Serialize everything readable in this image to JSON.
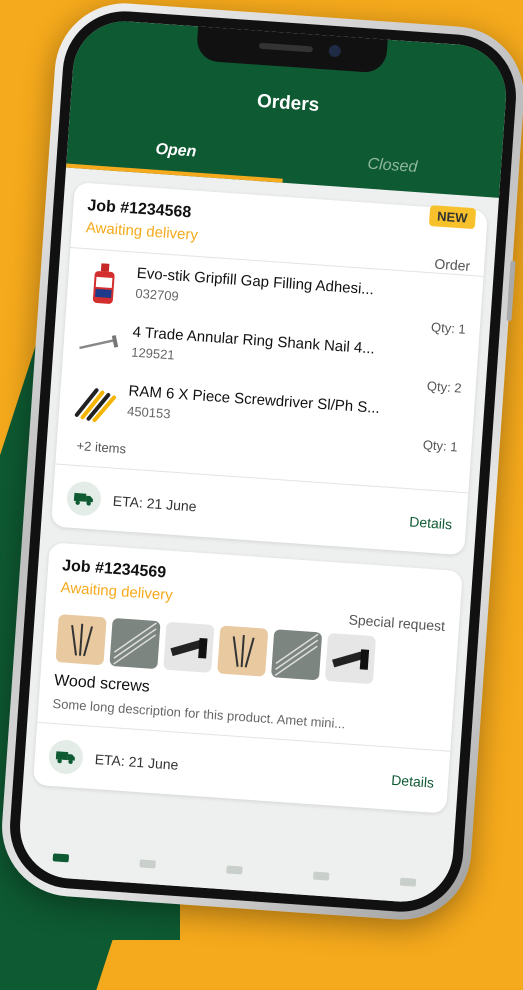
{
  "colors": {
    "brand_green": "#0e5a32",
    "accent": "#f5a91c"
  },
  "header": {
    "title": "Orders"
  },
  "tabs": [
    {
      "label": "Open",
      "active": true
    },
    {
      "label": "Closed",
      "active": false
    }
  ],
  "orders": [
    {
      "badge": "NEW",
      "job": "Job #1234568",
      "status": "Awaiting delivery",
      "type": "Order",
      "items": [
        {
          "name": "Evo-stik Gripfill Gap Filling Adhesi...",
          "code": "032709",
          "qty": "Qty: 1",
          "icon": "adhesive-bottle-icon"
        },
        {
          "name": "4 Trade Annular Ring Shank Nail 4...",
          "code": "129521",
          "qty": "Qty: 2",
          "icon": "nail-icon"
        },
        {
          "name": "RAM 6 X Piece Screwdriver Sl/Ph S...",
          "code": "450153",
          "qty": "Qty: 1",
          "icon": "screwdriver-set-icon"
        }
      ],
      "more": "+2 items",
      "eta": "ETA: 21 June",
      "details": "Details"
    },
    {
      "job": "Job #1234569",
      "status": "Awaiting delivery",
      "type": "Special request",
      "product_name": "Wood screws",
      "description": "Some long description for this product. Amet mini...",
      "eta": "ETA: 21 June",
      "details": "Details"
    }
  ]
}
